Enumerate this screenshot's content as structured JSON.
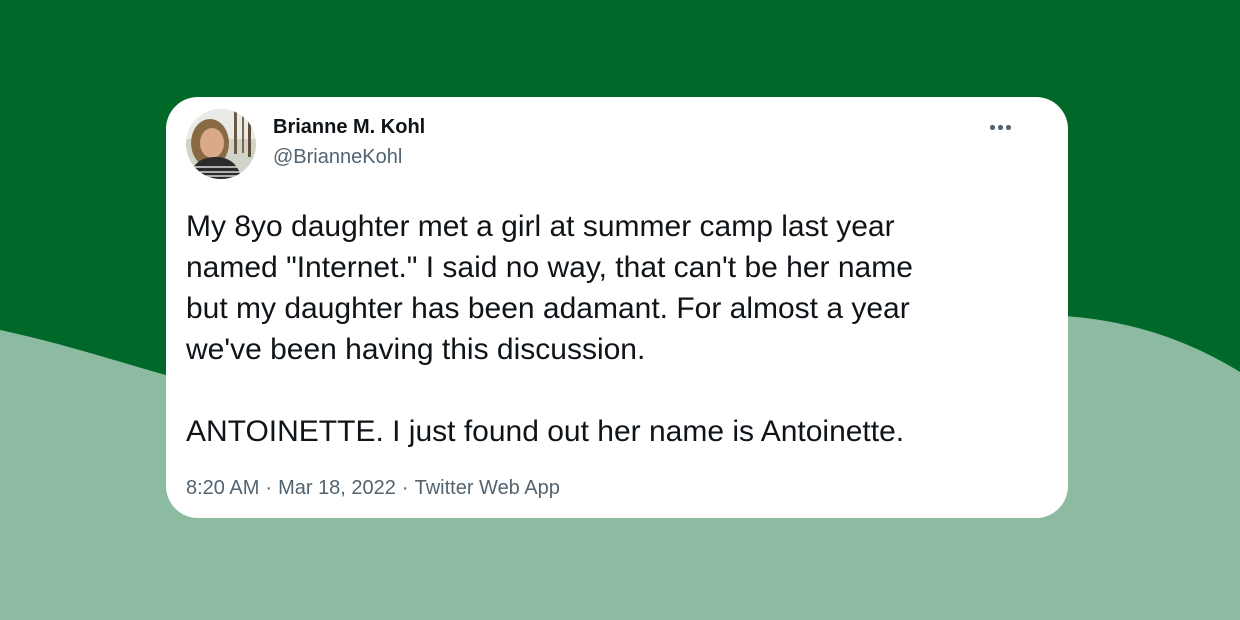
{
  "tweet": {
    "author": {
      "name": "Brianne M. Kohl",
      "handle": "@BrianneKohl"
    },
    "more_icon": "more-horizontal-icon",
    "body": [
      "My 8yo daughter met a girl at summer camp last year",
      "named \"Internet.\" I said no way, that can't be her name",
      "but my daughter has been adamant. For almost a year",
      "we've been having this discussion.",
      "ANTOINETTE. I just found out her name is Antoinette."
    ],
    "time": "8:20 AM",
    "date": "Mar 18, 2022",
    "source": "Twitter Web App",
    "separator": "·"
  },
  "colors": {
    "background_dark_green": "#006829",
    "background_light_green": "#8dbba2",
    "card": "#ffffff",
    "text_primary": "#0f1419",
    "text_secondary": "#536471"
  }
}
